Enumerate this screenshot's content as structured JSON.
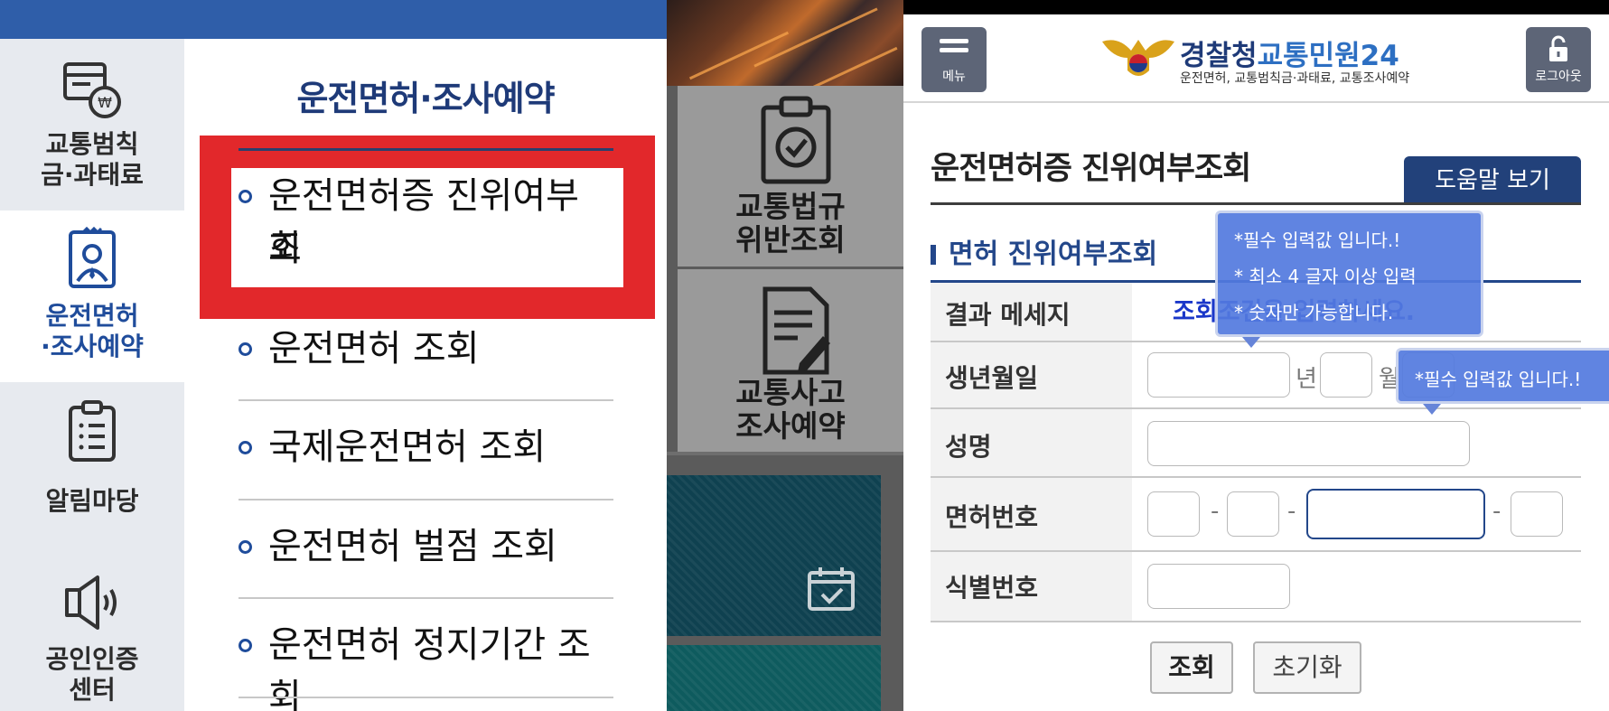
{
  "left_panel": {
    "nav": [
      {
        "label_line1": "교통범칙",
        "label_line2": "금·과태료",
        "icon": "fine-receipt-icon"
      },
      {
        "label_line1": "운전면허",
        "label_line2": "·조사예약",
        "icon": "license-id-icon"
      },
      {
        "label_line1": "알림마당",
        "label_line2": "",
        "icon": "clipboard-list-icon"
      },
      {
        "label_line1": "공인인증",
        "label_line2": "센터",
        "icon": "speaker-icon"
      }
    ],
    "menu_title": "운전면허·조사예약",
    "menu_items": [
      {
        "line1": "운전면허증 진위여부조",
        "line2": "회"
      },
      {
        "line1": "운전면허 조회",
        "line2": ""
      },
      {
        "line1": "국제운전면허 조회",
        "line2": ""
      },
      {
        "line1": "운전면허 벌점 조회",
        "line2": ""
      },
      {
        "line1": "운전면허 정지기간 조회",
        "line2": ""
      }
    ]
  },
  "middle_panel": {
    "cards": [
      {
        "line1": "교통법규",
        "line2": "위반조회",
        "icon": "clipboard-check-icon"
      },
      {
        "line1": "교통사고",
        "line2": "조사예약",
        "icon": "document-pen-icon"
      }
    ]
  },
  "right_panel": {
    "header": {
      "menu_label": "메뉴",
      "logout_label": "로그아웃",
      "logo_title_a": "경찰청",
      "logo_title_b": "교통민원24",
      "logo_sub": "운전면허, 교통범칙금·과태료, 교통조사예약"
    },
    "page_title": "운전면허증 진위여부조회",
    "help_button": "도움말 보기",
    "section_title": "면허 진위여부조회",
    "form": {
      "result_label": "결과 메세지",
      "result_message": "조회조건을 입력하세요.",
      "birth_label": "생년월일",
      "year_unit": "년",
      "month_unit": "월",
      "name_label": "성명",
      "license_label": "면허번호",
      "license_sep": "-",
      "id_label": "식별번호"
    },
    "buttons": {
      "search": "조회",
      "reset": "초기화"
    },
    "tooltip1": {
      "line1": "*필수 입력값 입니다.!",
      "line2": "* 최소 4 글자 이상 입력",
      "line3": "* 숫자만 가능합니다."
    },
    "tooltip2": {
      "line1": "*필수 입력값 입니다.!"
    },
    "colors": {
      "brand_blue": "#2f5ea9",
      "highlight_red": "#e2282b",
      "tooltip_blue": "#5279de"
    }
  }
}
